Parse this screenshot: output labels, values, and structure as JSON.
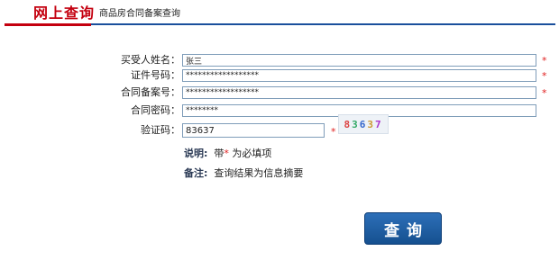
{
  "header": {
    "title": "网上查询",
    "subtitle": "商品房合同备案查询"
  },
  "form": {
    "buyer_name": {
      "label": "买受人姓名：",
      "value": "张三",
      "required_mark": "*"
    },
    "id_number": {
      "label": "证件号码：",
      "value": "******************",
      "required_mark": "*"
    },
    "contract_no": {
      "label": "合同备案号：",
      "value": "******************",
      "required_mark": "*"
    },
    "contract_password": {
      "label": "合同密码：",
      "value": "********"
    },
    "captcha": {
      "label": "验证码：",
      "value": "83637",
      "required_mark": "*",
      "image_text": [
        "8",
        "3",
        "6",
        "3",
        "7"
      ]
    }
  },
  "notes": {
    "explain_label": "说明:",
    "explain_prefix": "带",
    "explain_star": "*",
    "explain_suffix": "为必填项",
    "remark_label": "备注:",
    "remark_text": "查询结果为信息摘要"
  },
  "actions": {
    "query_label": "查询"
  },
  "colors": {
    "brand_red": "#c4000f",
    "header_blue": "#1a4f9c",
    "button_blue": "#1f5fa5",
    "required_red": "#e02020"
  }
}
